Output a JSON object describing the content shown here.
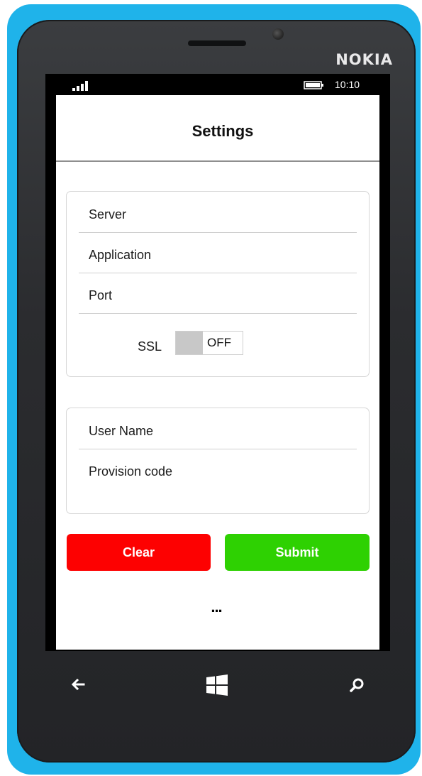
{
  "device": {
    "brand": "NOKIA"
  },
  "statusbar": {
    "time": "10:10",
    "signal_icon": "signal-bars-icon",
    "battery_icon": "battery-icon"
  },
  "header": {
    "title": "Settings"
  },
  "server_section": {
    "fields": [
      {
        "label": "Server"
      },
      {
        "label": "Application"
      },
      {
        "label": "Port"
      }
    ],
    "ssl": {
      "label": "SSL",
      "toggle_text": "OFF"
    }
  },
  "user_section": {
    "fields": [
      {
        "label": "User Name"
      },
      {
        "label": "Provision code"
      }
    ]
  },
  "actions": {
    "clear_label": "Clear",
    "submit_label": "Submit",
    "clear_color": "#fd0101",
    "submit_color": "#2ed102"
  },
  "appbar": {
    "more_label": "..."
  },
  "nav": {
    "back_icon": "back-arrow-icon",
    "start_icon": "windows-logo-icon",
    "search_icon": "search-icon"
  }
}
